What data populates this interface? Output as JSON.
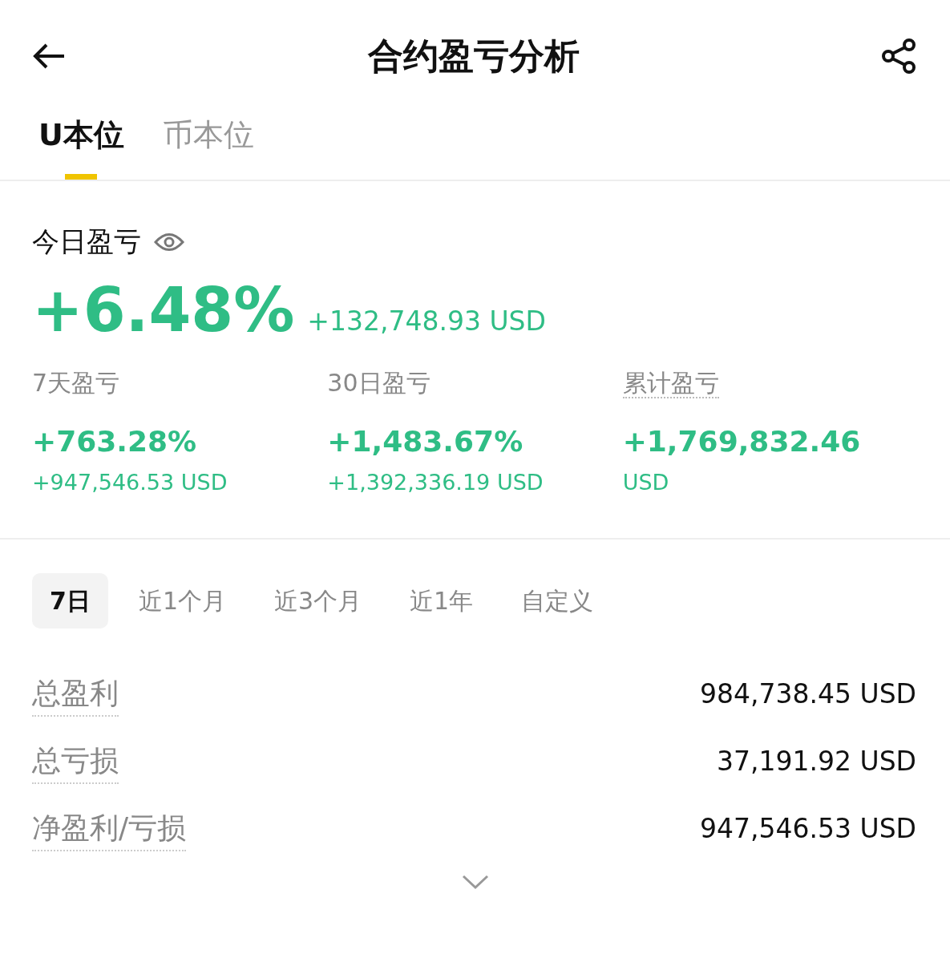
{
  "header": {
    "title": "合约盈亏分析"
  },
  "tabs": [
    {
      "label": "U本位",
      "selected": true
    },
    {
      "label": "币本位",
      "selected": false
    }
  ],
  "today": {
    "label": "今日盈亏",
    "percent": "+6.48%",
    "amount": "+132,748.93 USD"
  },
  "stats": [
    {
      "label": "7天盈亏",
      "dotted": false,
      "value": "+763.28%",
      "sub": "+947,546.53 USD"
    },
    {
      "label": "30日盈亏",
      "dotted": false,
      "value": "+1,483.67%",
      "sub": "+1,392,336.19 USD"
    },
    {
      "label": "累计盈亏",
      "dotted": true,
      "value": "+1,769,832.46",
      "sub": "USD"
    }
  ],
  "periods": [
    {
      "label": "7日",
      "selected": true
    },
    {
      "label": "近1个月",
      "selected": false
    },
    {
      "label": "近3个月",
      "selected": false
    },
    {
      "label": "近1年",
      "selected": false
    },
    {
      "label": "自定义",
      "selected": false
    }
  ],
  "rows": [
    {
      "label": "总盈利",
      "value": "984,738.45 USD"
    },
    {
      "label": "总亏损",
      "value": "37,191.92 USD"
    },
    {
      "label": "净盈利/亏损",
      "value": "947,546.53 USD"
    }
  ]
}
